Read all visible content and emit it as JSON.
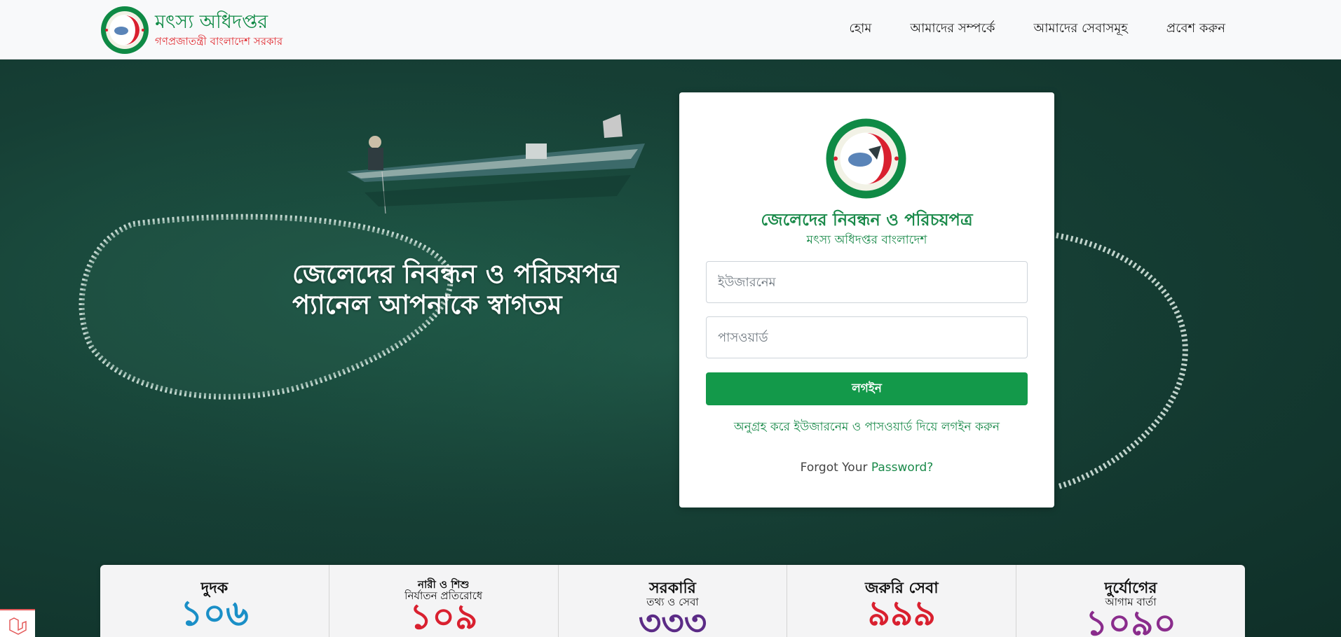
{
  "header": {
    "brand_title": "মৎস্য অধিদপ্তর",
    "brand_subtitle": "গণপ্রজাতন্ত্রী বাংলাদেশ সরকার",
    "nav": [
      "হোম",
      "আমাদের সম্পর্কে",
      "আমাদের সেবাসমূহ",
      "প্রবেশ করুন"
    ]
  },
  "hero": {
    "title_line1": "জেলেদের নিবন্ধন ও পরিচয়পত্র",
    "title_line2": "প্যানেল আপনাকে স্বাগতম"
  },
  "login": {
    "title": "জেলেদের নিবন্ধন ও পরিচয়পত্র",
    "subtitle": "মৎস্য অধিদপ্তর বাংলাদেশ",
    "username_placeholder": "ইউজারনেম",
    "password_placeholder": "পাসওয়ার্ড",
    "login_button": "লগইন",
    "hint": "অনুগ্রহ করে ইউজারনেম ও পাসওয়ার্ড দিয়ে লগইন করুন",
    "forgot_prefix": "Forgot Your ",
    "forgot_link": "Password?"
  },
  "hotlines": [
    {
      "label": "দুদক",
      "label2": "",
      "number": "১০৬",
      "color": "#1a8fc7"
    },
    {
      "label": "নারী ও শিশু",
      "label2": "নির্যাতন প্রতিরোধে",
      "number": "১০৯",
      "color": "#d9202f"
    },
    {
      "label": "সরকারি",
      "label2": "তথ্য ও সেবা",
      "number": "৩৩৩",
      "color": "#5b2b86"
    },
    {
      "label": "জরুরি সেবা",
      "label2": "",
      "number": "৯৯৯",
      "color": "#d9202f"
    },
    {
      "label": "দুর্যোগের",
      "label2": "আগাম বার্তা",
      "number": "১০৯০",
      "color": "#8a2c8c"
    }
  ],
  "icons": [
    "emblem-logo-icon",
    "laravel-icon"
  ],
  "colors": {
    "brand_green": "#0f8a45",
    "brand_red": "#e0262c",
    "button_green": "#13994a"
  }
}
